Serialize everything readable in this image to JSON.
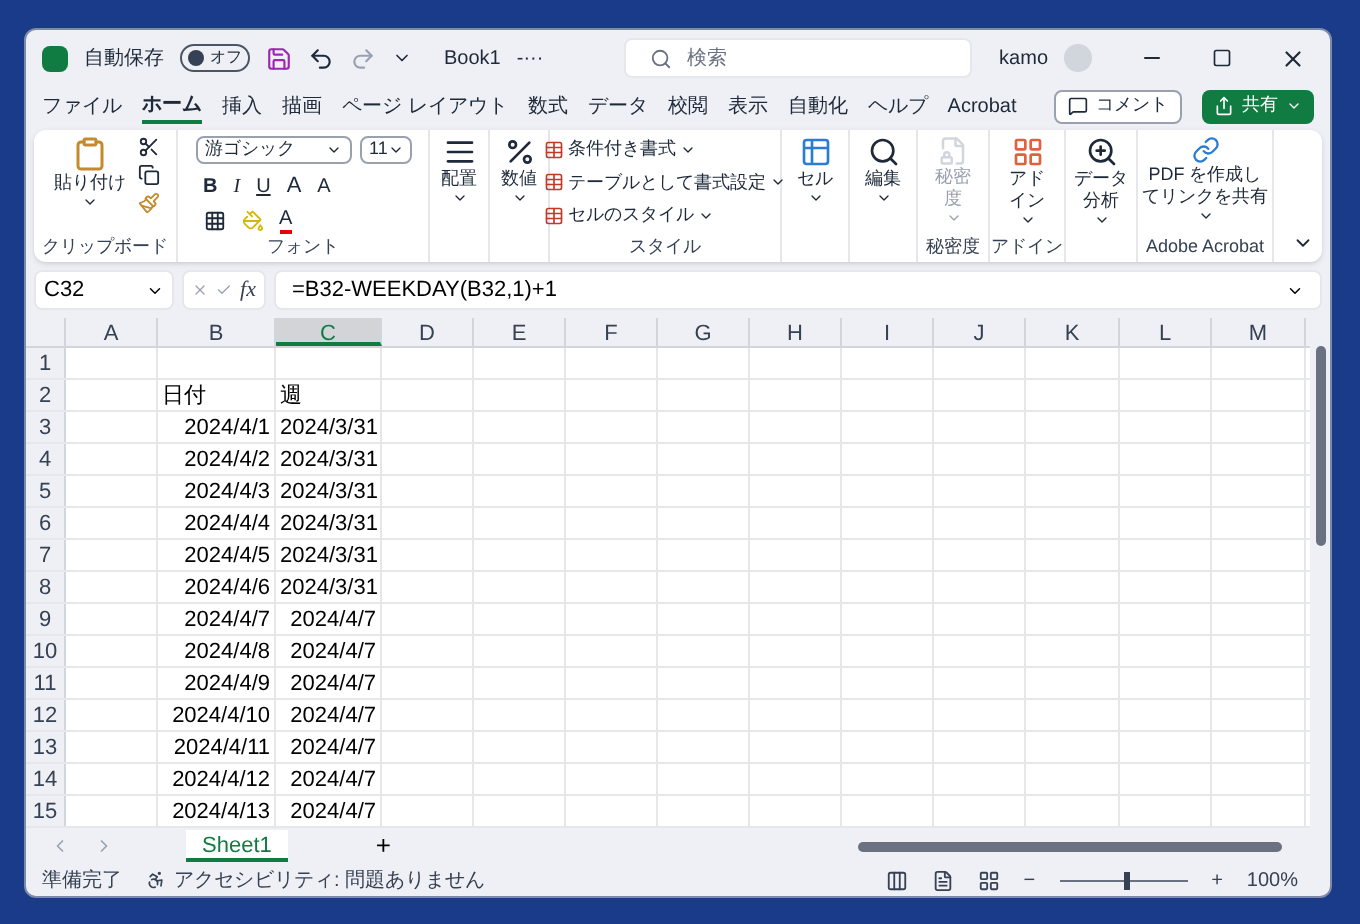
{
  "titlebar": {
    "autosave_label": "自動保存",
    "autosave": {
      "on": false,
      "label": "オフ"
    },
    "title": "Book1",
    "title_suffix": "-···",
    "search_placeholder": "検索",
    "user": "kamo"
  },
  "menu": {
    "tabs": [
      {
        "label": "ファイル",
        "selected": false
      },
      {
        "label": "ホーム",
        "selected": true
      },
      {
        "label": "挿入",
        "selected": false
      },
      {
        "label": "描画",
        "selected": false
      },
      {
        "label": "ページ レイアウト",
        "selected": false
      },
      {
        "label": "数式",
        "selected": false
      },
      {
        "label": "データ",
        "selected": false
      },
      {
        "label": "校閲",
        "selected": false
      },
      {
        "label": "表示",
        "selected": false
      },
      {
        "label": "自動化",
        "selected": false
      },
      {
        "label": "ヘルプ",
        "selected": false
      },
      {
        "label": "Acrobat",
        "selected": false
      }
    ],
    "comment_button": "コメント",
    "share_button": "共有"
  },
  "ribbon": {
    "clipboard": {
      "paste": [
        "貼り付け"
      ],
      "label": "クリップボード"
    },
    "font": {
      "name": "游ゴシック",
      "size": "11",
      "bold": "B",
      "italic": "I",
      "underline": "U",
      "grow": "A",
      "shrink": "A",
      "color_letter": "A",
      "label": "フォント"
    },
    "alignment": [
      "配置"
    ],
    "number": [
      "数値"
    ],
    "styles": {
      "items": [
        "条件付き書式",
        "テーブルとして書式設定",
        "セルのスタイル"
      ],
      "label": "スタイル"
    },
    "cells": [
      "セル"
    ],
    "editing": [
      "編集"
    ],
    "sensitivity": {
      "button": [
        "秘密",
        "度"
      ],
      "label": "秘密度",
      "disabled": true
    },
    "addins": {
      "button": [
        "アド",
        "イン"
      ],
      "label": "アドイン"
    },
    "analysis": [
      "データ",
      "分析"
    ],
    "acrobat": {
      "button": [
        "PDF を作成し",
        "てリンクを共有"
      ],
      "label": "Adobe Acrobat"
    }
  },
  "formula_bar": {
    "name_box": "C32",
    "function_label": "fx",
    "formula": "=B32-WEEKDAY(B32,1)+1"
  },
  "sheet": {
    "columns": [
      {
        "label": "A",
        "selected": false
      },
      {
        "label": "B",
        "selected": false
      },
      {
        "label": "C",
        "selected": true
      },
      {
        "label": "D",
        "selected": false
      },
      {
        "label": "E",
        "selected": false
      },
      {
        "label": "F",
        "selected": false
      },
      {
        "label": "G",
        "selected": false
      },
      {
        "label": "H",
        "selected": false
      },
      {
        "label": "I",
        "selected": false
      },
      {
        "label": "J",
        "selected": false
      },
      {
        "label": "K",
        "selected": false
      },
      {
        "label": "L",
        "selected": false
      },
      {
        "label": "M",
        "selected": false
      }
    ],
    "rows": [
      {
        "n": "1"
      },
      {
        "n": "2",
        "b": "日付",
        "c": "週"
      },
      {
        "n": "3",
        "b": "2024/4/1",
        "c": "2024/3/31"
      },
      {
        "n": "4",
        "b": "2024/4/2",
        "c": "2024/3/31"
      },
      {
        "n": "5",
        "b": "2024/4/3",
        "c": "2024/3/31"
      },
      {
        "n": "6",
        "b": "2024/4/4",
        "c": "2024/3/31"
      },
      {
        "n": "7",
        "b": "2024/4/5",
        "c": "2024/3/31"
      },
      {
        "n": "8",
        "b": "2024/4/6",
        "c": "2024/3/31"
      },
      {
        "n": "9",
        "b": "2024/4/7",
        "c": "2024/4/7"
      },
      {
        "n": "10",
        "b": "2024/4/8",
        "c": "2024/4/7"
      },
      {
        "n": "11",
        "b": "2024/4/9",
        "c": "2024/4/7"
      },
      {
        "n": "12",
        "b": "2024/4/10",
        "c": "2024/4/7"
      },
      {
        "n": "13",
        "b": "2024/4/11",
        "c": "2024/4/7"
      },
      {
        "n": "14",
        "b": "2024/4/12",
        "c": "2024/4/7"
      },
      {
        "n": "15",
        "b": "2024/4/13",
        "c": "2024/4/7"
      }
    ]
  },
  "sheet_tabs": [
    {
      "label": "Sheet1",
      "selected": true
    }
  ],
  "add_sheet": "+",
  "status_bar": {
    "status": "準備完了",
    "accessibility": "アクセシビリティ: 問題ありません",
    "zoom_minus": "−",
    "zoom_plus": "+",
    "zoom": "100%",
    "zoom_slider": {
      "level": 0.5
    }
  }
}
